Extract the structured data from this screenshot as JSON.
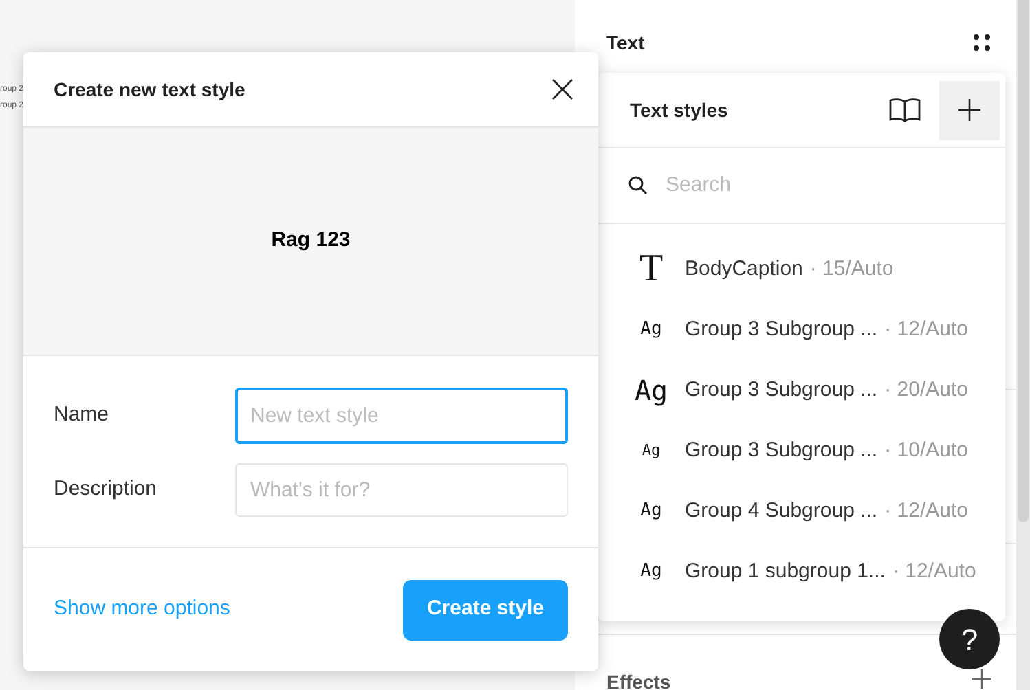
{
  "canvas": {
    "labels": [
      "roup 2",
      "roup 2"
    ]
  },
  "dialog": {
    "title": "Create new text style",
    "preview": "Rag 123",
    "fields": [
      {
        "label": "Name",
        "placeholder": "New text style",
        "focused": true
      },
      {
        "label": "Description",
        "placeholder": "What's it for?",
        "focused": false
      }
    ],
    "link": "Show more options",
    "button": "Create style"
  },
  "panel": {
    "section": "Text",
    "bottom_section": "Effects"
  },
  "styles_popup": {
    "title": "Text styles",
    "search": {
      "placeholder": "Search"
    },
    "items": [
      {
        "kind": "type",
        "icon": "T",
        "name": "BodyCaption",
        "meta": "· 15/Auto"
      },
      {
        "kind": "sample",
        "icon": "Ag",
        "name": "Group 3 Subgroup ...",
        "meta": "· 12/Auto"
      },
      {
        "kind": "sample-large",
        "icon": "Ag",
        "name": "Group 3 Subgroup ...",
        "meta": "· 20/Auto"
      },
      {
        "kind": "sample-small",
        "icon": "Ag",
        "name": "Group 3 Subgroup ...",
        "meta": "· 10/Auto"
      },
      {
        "kind": "sample",
        "icon": "Ag",
        "name": "Group 4 Subgroup ...",
        "meta": "· 12/Auto"
      },
      {
        "kind": "sample",
        "icon": "Ag",
        "name": "Group 1 subgroup 1...",
        "meta": "· 12/Auto"
      }
    ]
  },
  "help_button": "?"
}
